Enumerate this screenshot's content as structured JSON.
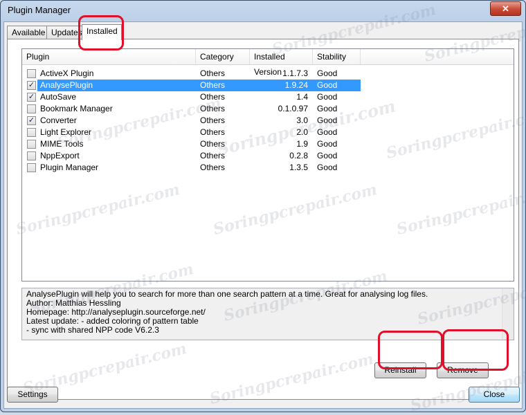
{
  "window": {
    "title": "Plugin Manager",
    "close_glyph": "✕"
  },
  "tabs": [
    {
      "label": "Available"
    },
    {
      "label": "Updates"
    },
    {
      "label": "Installed"
    }
  ],
  "list": {
    "columns": [
      "Plugin",
      "Category",
      "Installed Version",
      "Stability"
    ],
    "rows": [
      {
        "checked": false,
        "name": "ActiveX Plugin",
        "category": "Others",
        "version": "1.1.7.3",
        "stability": "Good"
      },
      {
        "checked": true,
        "name": "AnalysePlugin",
        "category": "Others",
        "version": "1.9.24",
        "stability": "Good",
        "selected": true
      },
      {
        "checked": true,
        "name": "AutoSave",
        "category": "Others",
        "version": "1.4",
        "stability": "Good"
      },
      {
        "checked": false,
        "name": "Bookmark Manager",
        "category": "Others",
        "version": "0.1.0.97",
        "stability": "Good"
      },
      {
        "checked": true,
        "name": "Converter",
        "category": "Others",
        "version": "3.0",
        "stability": "Good"
      },
      {
        "checked": false,
        "name": "Light Explorer",
        "category": "Others",
        "version": "2.0",
        "stability": "Good"
      },
      {
        "checked": false,
        "name": "MIME Tools",
        "category": "Others",
        "version": "1.9",
        "stability": "Good"
      },
      {
        "checked": false,
        "name": "NppExport",
        "category": "Others",
        "version": "0.2.8",
        "stability": "Good"
      },
      {
        "checked": false,
        "name": "Plugin Manager",
        "category": "Others",
        "version": "1.3.5",
        "stability": "Good"
      }
    ]
  },
  "description": {
    "lines": [
      "AnalysePlugin will help you to search for more than one search pattern at a time. Great for analysing log files.",
      "Author: Matthias Hessling",
      "Homepage: http://analyseplugin.sourceforge.net/",
      "Latest update: - added coloring of pattern table",
      " - sync with shared NPP code V6.2.3"
    ]
  },
  "buttons": {
    "reinstall": "Reinstall",
    "remove": "Remove",
    "settings": "Settings",
    "close": "Close"
  },
  "watermark": "Soringpcrepair.com",
  "colors": {
    "selection": "#3399ff",
    "highlight_marker": "#e0102a"
  }
}
